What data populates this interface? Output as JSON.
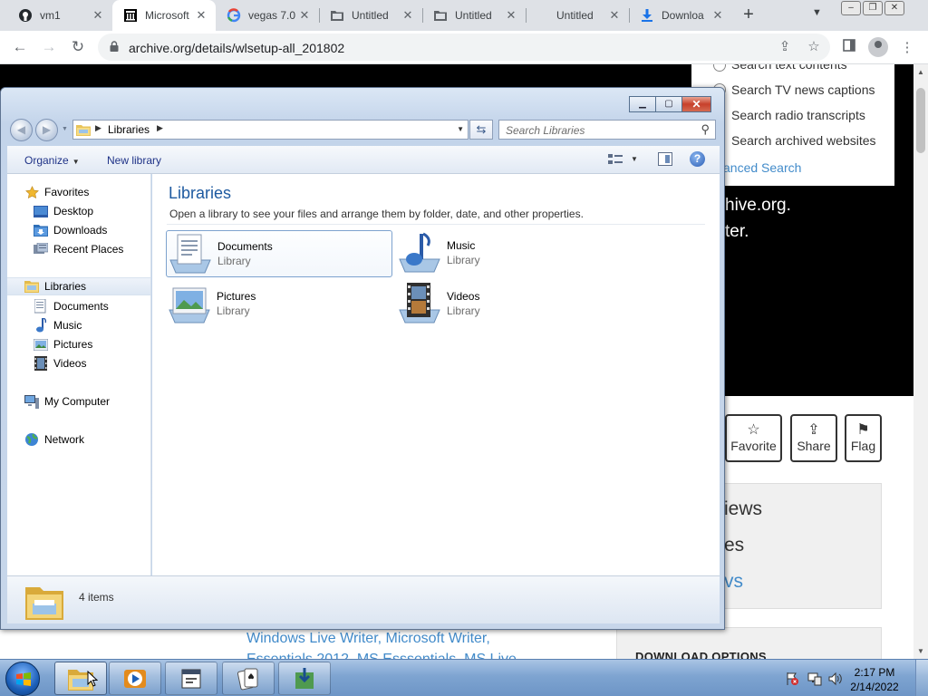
{
  "browser": {
    "tabs": [
      {
        "title": "vm1",
        "icon": "github-icon"
      },
      {
        "title": "Microsoft",
        "icon": "archive-org-icon",
        "active": true
      },
      {
        "title": "vegas 7.0",
        "icon": "google-icon"
      },
      {
        "title": "Untitled",
        "icon": "folder-icon"
      },
      {
        "title": "Untitled",
        "icon": "folder-icon"
      },
      {
        "title": "Untitled",
        "icon": ""
      },
      {
        "title": "Downloa",
        "icon": "download-icon"
      }
    ],
    "url": "archive.org/details/wlsetup-all_201802"
  },
  "webpage": {
    "search_options": [
      "Search text contents",
      "Search TV news captions",
      "Search radio transcripts",
      "Search archived websites"
    ],
    "advanced_search": "vanced Search",
    "hero_line1": "hive.org.",
    "hero_line2": "ter.",
    "actions": {
      "favorite": "Favorite",
      "share": "Share",
      "flag": "Flag"
    },
    "box_lines": [
      "iews",
      "es",
      "vs"
    ],
    "keywords_line1": "Windows Live Writer, Microsoft Writer,",
    "keywords_line2": "Essentials 2012, MS Esssentials, MS Live",
    "download_options": "DOWNLOAD OPTIONS"
  },
  "explorer": {
    "address": "Libraries",
    "search_placeholder": "Search Libraries",
    "organize": "Organize",
    "new_library": "New library",
    "nav": {
      "favorites": "Favorites",
      "desktop": "Desktop",
      "downloads": "Downloads",
      "recent_places": "Recent Places",
      "libraries": "Libraries",
      "documents": "Documents",
      "music": "Music",
      "pictures": "Pictures",
      "videos": "Videos",
      "my_computer": "My Computer",
      "network": "Network"
    },
    "heading": "Libraries",
    "subheading": "Open a library to see your files and arrange them by folder, date, and other properties.",
    "libraries": [
      {
        "name": "Documents",
        "type": "Library"
      },
      {
        "name": "Music",
        "type": "Library"
      },
      {
        "name": "Pictures",
        "type": "Library"
      },
      {
        "name": "Videos",
        "type": "Library"
      }
    ],
    "item_count": "4 items"
  },
  "taskbar": {
    "time": "2:17 PM",
    "date": "2/14/2022"
  },
  "colors": {
    "link": "#428bca",
    "explorer_heading": "#1e5aa0",
    "taskbar": "#7ea4d1"
  }
}
